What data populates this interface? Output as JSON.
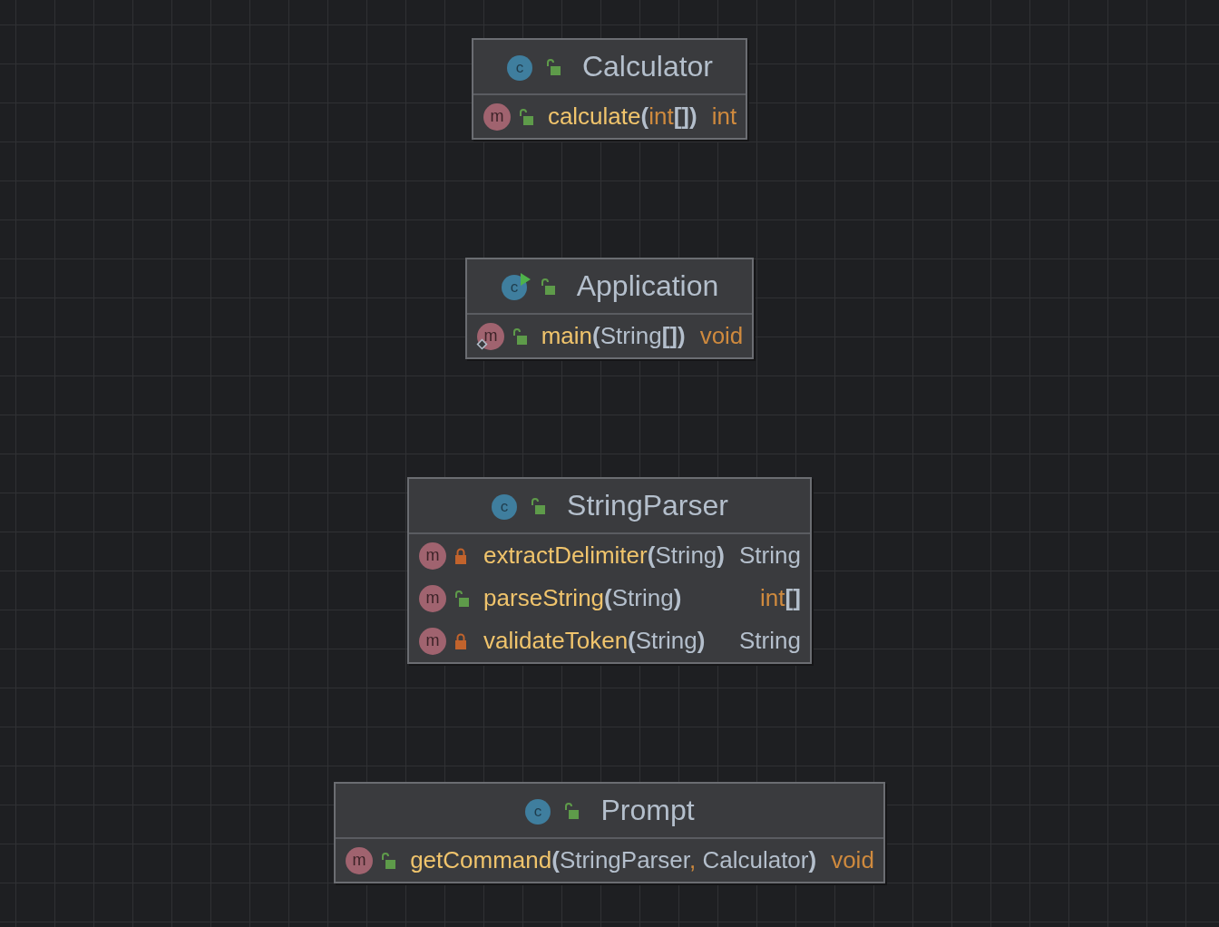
{
  "diagram": {
    "classes": [
      {
        "name": "Calculator",
        "badge": "c",
        "runnable": false,
        "private": false,
        "members": [
          {
            "badge": "m",
            "private": false,
            "entry": false,
            "signature": [
              {
                "text": "calculate",
                "kind": "name"
              },
              {
                "text": "(",
                "kind": "punct"
              },
              {
                "text": "int",
                "kind": "keyword"
              },
              {
                "text": "[]",
                "kind": "punct"
              },
              {
                "text": ")",
                "kind": "punct"
              }
            ],
            "returns": {
              "text": "int",
              "kind": "keyword"
            }
          }
        ]
      },
      {
        "name": "Application",
        "badge": "c",
        "runnable": true,
        "private": false,
        "members": [
          {
            "badge": "m",
            "private": false,
            "entry": true,
            "signature": [
              {
                "text": "main",
                "kind": "name"
              },
              {
                "text": "(",
                "kind": "punct"
              },
              {
                "text": "String",
                "kind": "type"
              },
              {
                "text": "[]",
                "kind": "punct"
              },
              {
                "text": ")",
                "kind": "punct"
              }
            ],
            "returns": {
              "text": "void",
              "kind": "keyword"
            }
          }
        ]
      },
      {
        "name": "StringParser",
        "badge": "c",
        "runnable": false,
        "private": false,
        "members": [
          {
            "badge": "m",
            "private": true,
            "entry": false,
            "signature": [
              {
                "text": "extractDelimiter",
                "kind": "name"
              },
              {
                "text": "(",
                "kind": "punct"
              },
              {
                "text": "String",
                "kind": "type"
              },
              {
                "text": ")",
                "kind": "punct"
              }
            ],
            "returns": {
              "text": "String",
              "kind": "type"
            }
          },
          {
            "badge": "m",
            "private": false,
            "entry": false,
            "signature": [
              {
                "text": "parseString",
                "kind": "name"
              },
              {
                "text": "(",
                "kind": "punct"
              },
              {
                "text": "String",
                "kind": "type"
              },
              {
                "text": ")",
                "kind": "punct"
              }
            ],
            "returns": {
              "text": "int",
              "kind": "keyword",
              "suffix": "[]"
            }
          },
          {
            "badge": "m",
            "private": true,
            "entry": false,
            "signature": [
              {
                "text": "validateToken",
                "kind": "name"
              },
              {
                "text": "(",
                "kind": "punct"
              },
              {
                "text": "String",
                "kind": "type"
              },
              {
                "text": ")",
                "kind": "punct"
              }
            ],
            "returns": {
              "text": "String",
              "kind": "type"
            }
          }
        ]
      },
      {
        "name": "Prompt",
        "badge": "c",
        "runnable": false,
        "private": false,
        "members": [
          {
            "badge": "m",
            "private": false,
            "entry": false,
            "signature": [
              {
                "text": "getCommand",
                "kind": "name"
              },
              {
                "text": "(",
                "kind": "punct"
              },
              {
                "text": "StringParser",
                "kind": "type"
              },
              {
                "text": ",",
                "kind": "keyword"
              },
              {
                "text": " Calculator",
                "kind": "type"
              },
              {
                "text": ")",
                "kind": "punct"
              }
            ],
            "returns": {
              "text": "void",
              "kind": "keyword"
            }
          }
        ]
      }
    ]
  }
}
